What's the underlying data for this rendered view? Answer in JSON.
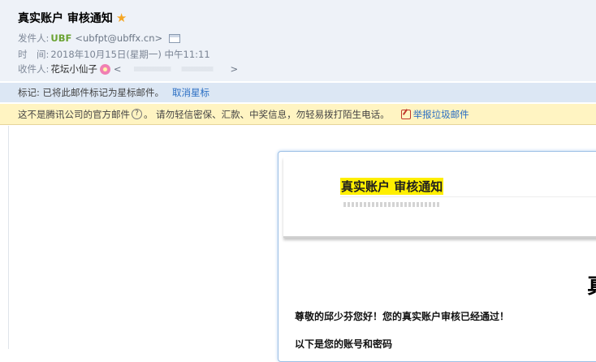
{
  "header": {
    "subject": "真实账户 审核通知",
    "from_label": "发件人:",
    "sender_name": "UBF",
    "sender_email": "<ubfpt@ubffx.cn>",
    "time_label": "时　间:",
    "time_value": "2018年10月15日(星期一) 中午11:11",
    "to_label": "收件人:",
    "recipient_name": "花坛小仙子",
    "recipient_email_open": "<",
    "recipient_email_close": ">"
  },
  "flag_bar": {
    "text": "标记: 已将此邮件标记为星标邮件。",
    "action": "取消星标"
  },
  "notice_bar": {
    "text_before": "这不是腾讯公司的官方邮件",
    "help_glyph": "?",
    "text_after": "。 请勿轻信密保、汇款、中奖信息，勿轻易拨打陌生电话。",
    "report": "举报垃圾邮件"
  },
  "mail": {
    "banner_title": "真实账户 审核通知",
    "big_char": "真",
    "greeting": "尊敬的邱少芬您好！您的真实账户审核已经通过！",
    "account_intro": "以下是您的账号和密码"
  },
  "colors": {
    "accent_link": "#2a6ec3",
    "sender_green": "#6aa332",
    "star": "#f5a623",
    "highlight": "#ffef00"
  },
  "icons": {
    "star": "star-icon",
    "contact_card": "contact-card-icon",
    "flower": "flower-icon",
    "help": "help-icon",
    "report": "report-icon"
  }
}
